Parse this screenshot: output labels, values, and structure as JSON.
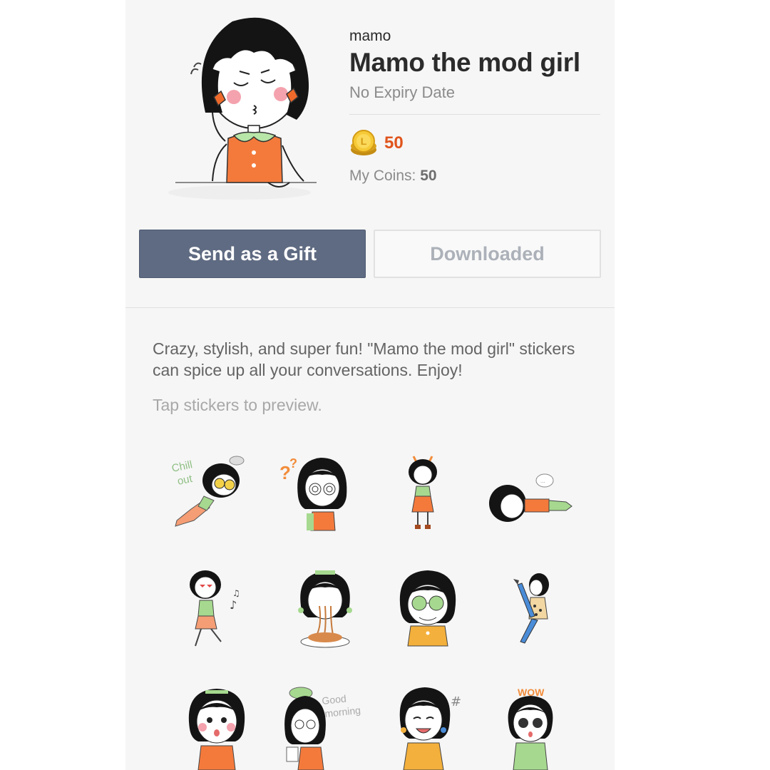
{
  "sticker_pack": {
    "author": "mamo",
    "title": "Mamo the mod girl",
    "expiry": "No Expiry Date",
    "price": "50",
    "my_coins_label": "My Coins:",
    "my_coins_value": "50"
  },
  "actions": {
    "gift_label": "Send as a Gift",
    "downloaded_label": "Downloaded"
  },
  "description": "Crazy, stylish, and super fun! \"Mamo the mod girl\" stickers can spice up all your conversations. Enjoy!",
  "hint": "Tap stickers to preview.",
  "sticker_text": {
    "chill": [
      "Chill",
      "out"
    ],
    "good_morning": [
      "Good",
      "morning"
    ],
    "wow": "WOW"
  },
  "colors": {
    "accent_price": "#e0541c",
    "gift_button": "#5f6b82",
    "panel_bg": "#f6f6f6"
  }
}
